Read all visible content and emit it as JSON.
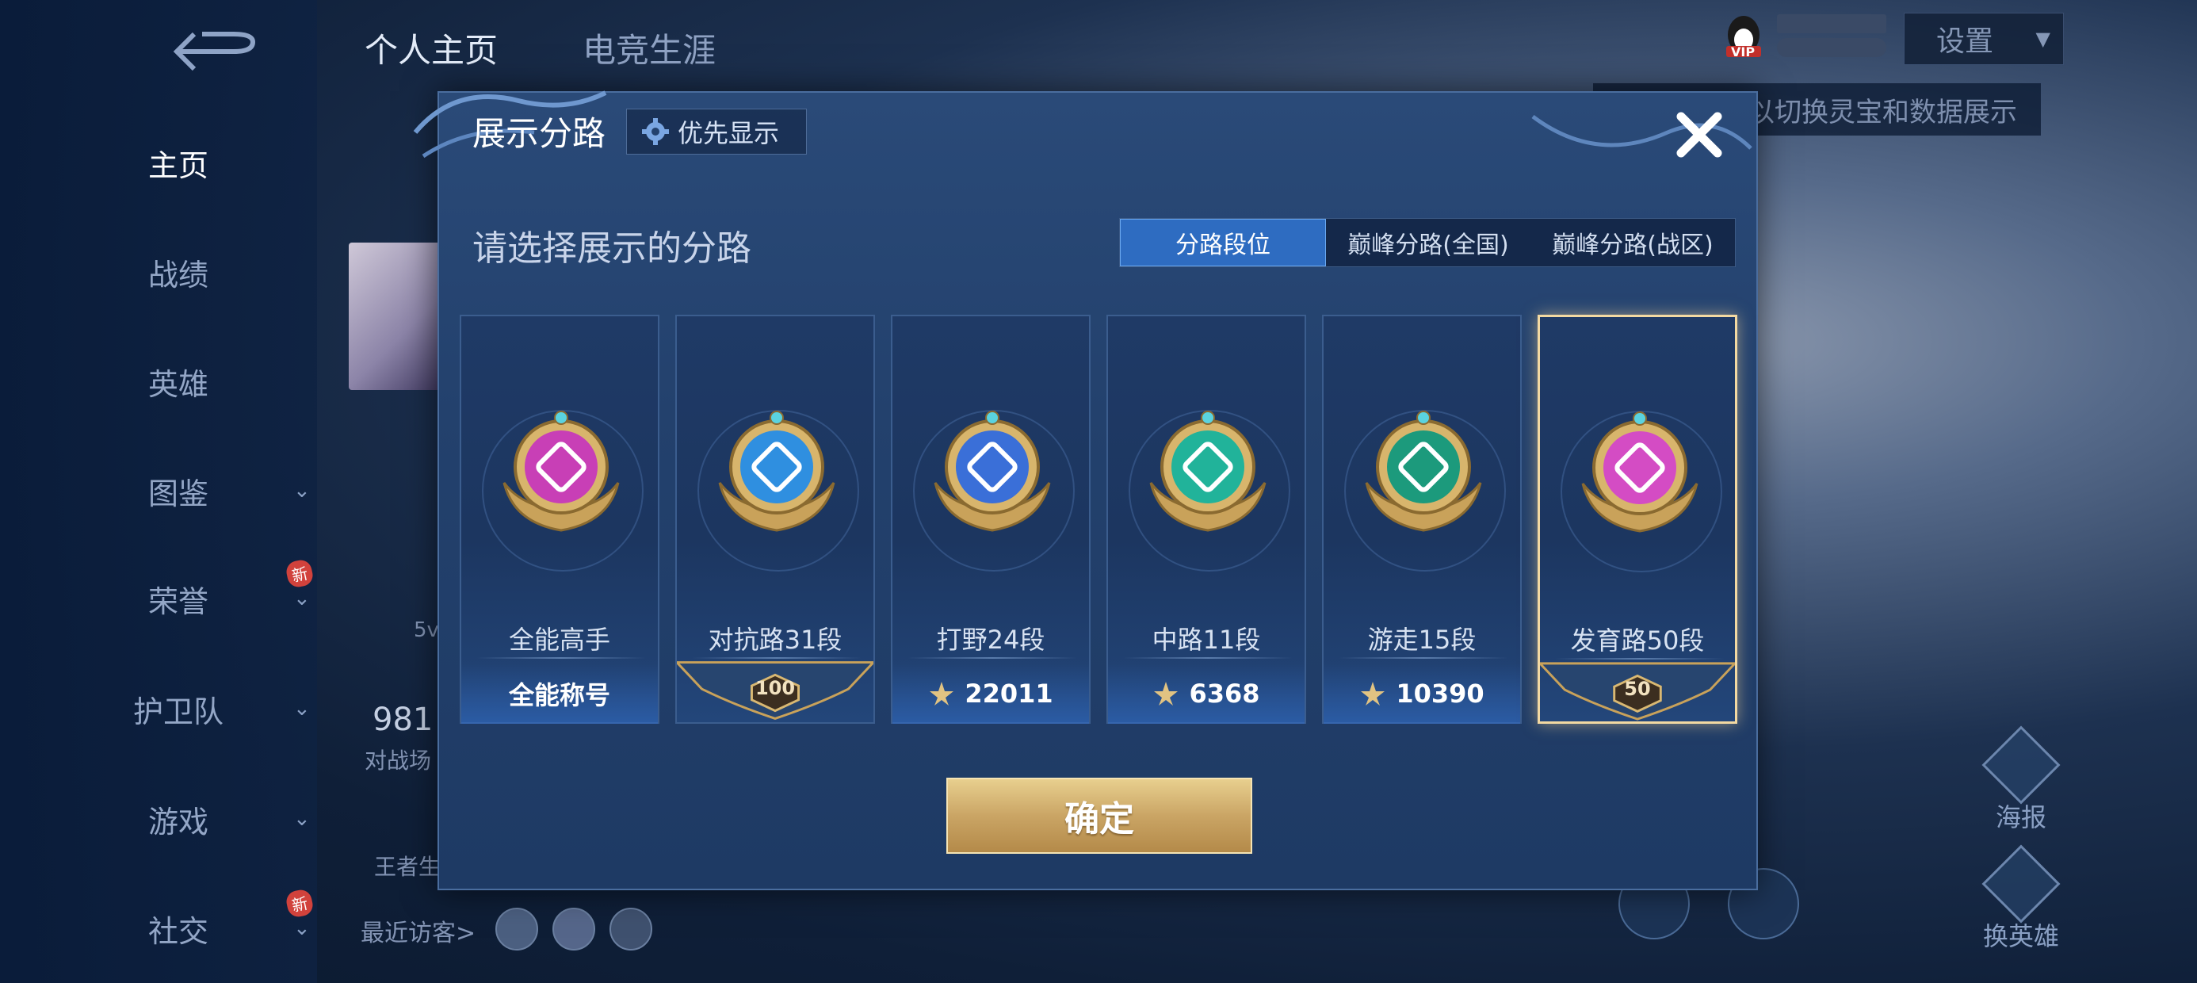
{
  "sidebar": {
    "items": [
      {
        "label": "主页",
        "active": true
      },
      {
        "label": "战绩"
      },
      {
        "label": "英雄"
      },
      {
        "label": "图鉴",
        "has_chevron": true
      },
      {
        "label": "荣誉",
        "has_chevron": true,
        "badge": "新"
      },
      {
        "label": "护卫队",
        "has_chevron": true
      },
      {
        "label": "游戏",
        "has_chevron": true
      },
      {
        "label": "社交",
        "has_chevron": true,
        "badge": "新"
      }
    ]
  },
  "topnav": {
    "tabs": [
      {
        "label": "个人主页",
        "active": true
      },
      {
        "label": "电竞生涯"
      }
    ]
  },
  "header": {
    "setting_label": "设置",
    "vip_label": "VIP",
    "hint_text": "以切换灵宝和数据展示"
  },
  "background": {
    "visits_label": "最近访客>",
    "stat_value": "981",
    "stat_label": "对战场",
    "partial_text": "王者生",
    "badge_text": "5v",
    "poster_label": "海报",
    "switch_hero_label": "换英雄"
  },
  "modal": {
    "title": "展示分路",
    "priority_label": "优先显示",
    "subtitle": "请选择展示的分路",
    "tabs": [
      {
        "label": "分路段位",
        "active": true
      },
      {
        "label": "巅峰分路(全国)"
      },
      {
        "label": "巅峰分路(战区)"
      }
    ],
    "confirm_label": "确定"
  },
  "lanes": [
    {
      "name": "全能高手",
      "bottom": "全能称号",
      "kind": "title",
      "emblem_color": "#c83fb6",
      "emblem_icon": "allround-icon"
    },
    {
      "name": "对抗路31段",
      "bottom": "100",
      "kind": "rank",
      "emblem_color": "#2f8fe0",
      "emblem_icon": "clash-lane-icon"
    },
    {
      "name": "打野24段",
      "bottom": "22011",
      "kind": "points",
      "emblem_color": "#3a6fd8",
      "emblem_icon": "jungle-icon"
    },
    {
      "name": "中路11段",
      "bottom": "6368",
      "kind": "points",
      "emblem_color": "#21b39a",
      "emblem_icon": "mid-lane-icon"
    },
    {
      "name": "游走15段",
      "bottom": "10390",
      "kind": "points",
      "emblem_color": "#1c9a7c",
      "emblem_icon": "roam-icon"
    },
    {
      "name": "发育路50段",
      "bottom": "50",
      "kind": "rank",
      "emblem_color": "#d44cc4",
      "emblem_icon": "farm-lane-icon",
      "selected": true
    }
  ]
}
